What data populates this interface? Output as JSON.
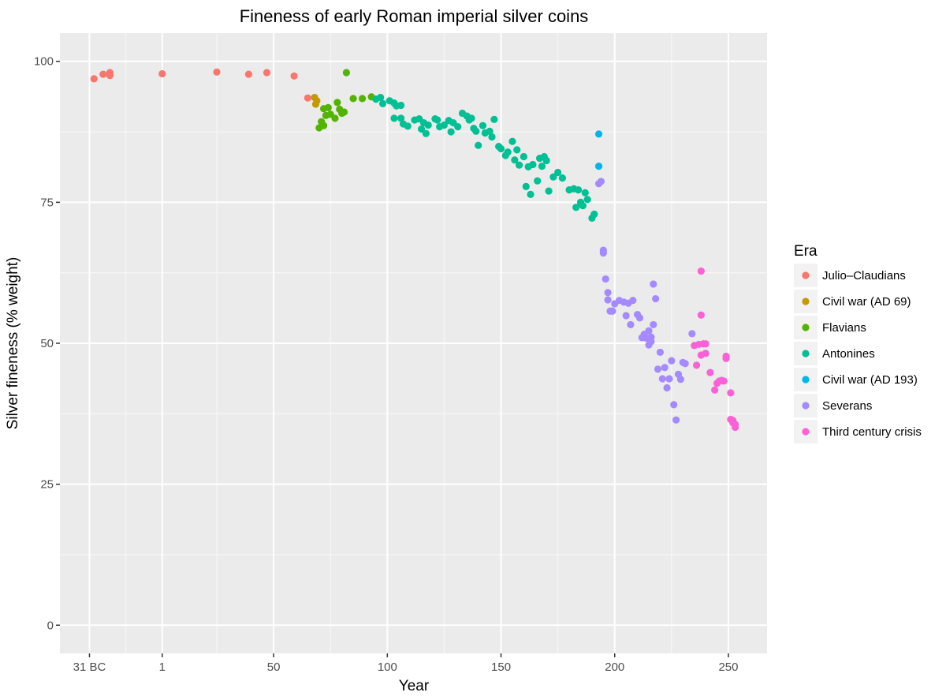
{
  "chart_data": {
    "type": "scatter",
    "title": "Fineness of early Roman imperial silver coins",
    "xlabel": "Year",
    "ylabel": "Silver fineness (% weight)",
    "xlim": [
      -44,
      267
    ],
    "ylim": [
      -5,
      105
    ],
    "x_ticks": [
      {
        "value": -31,
        "label": "31 BC"
      },
      {
        "value": 1,
        "label": "1"
      },
      {
        "value": 50,
        "label": "50"
      },
      {
        "value": 100,
        "label": "100"
      },
      {
        "value": 150,
        "label": "150"
      },
      {
        "value": 200,
        "label": "200"
      },
      {
        "value": 250,
        "label": "250"
      }
    ],
    "x_minor": [
      -15,
      25,
      75,
      125,
      175,
      225
    ],
    "y_ticks": [
      {
        "value": 0,
        "label": "0"
      },
      {
        "value": 25,
        "label": "25"
      },
      {
        "value": 50,
        "label": "50"
      },
      {
        "value": 75,
        "label": "75"
      },
      {
        "value": 100,
        "label": "100"
      }
    ],
    "y_minor": [
      12.5,
      37.5,
      62.5,
      87.5
    ],
    "grid": true,
    "legend": {
      "title": "Era",
      "placement": "right"
    },
    "series": [
      {
        "name": "Julio–Claudians",
        "color": "#F8766D",
        "points": [
          [
            -29,
            96.9
          ],
          [
            -25,
            97.7
          ],
          [
            -22,
            98.0
          ],
          [
            -22,
            97.5
          ],
          [
            1,
            97.8
          ],
          [
            25,
            98.1
          ],
          [
            39,
            97.7
          ],
          [
            47,
            98.0
          ],
          [
            59,
            97.4
          ],
          [
            65,
            93.5
          ]
        ]
      },
      {
        "name": "Civil war (AD 69)",
        "color": "#C49A00",
        "points": [
          [
            68,
            93.6
          ],
          [
            69,
            93.0
          ],
          [
            68.5,
            92.4
          ]
        ]
      },
      {
        "name": "Flavians",
        "color": "#53B400",
        "points": [
          [
            72,
            91.6
          ],
          [
            74,
            91.8
          ],
          [
            78,
            92.7
          ],
          [
            75,
            90.6
          ],
          [
            73,
            90.4
          ],
          [
            79,
            91.5
          ],
          [
            80,
            90.8
          ],
          [
            81,
            91.0
          ],
          [
            77,
            89.9
          ],
          [
            71,
            89.3
          ],
          [
            72,
            88.6
          ],
          [
            70,
            88.2
          ],
          [
            82,
            98.0
          ],
          [
            85,
            93.4
          ],
          [
            89,
            93.4
          ],
          [
            93,
            93.7
          ]
        ]
      },
      {
        "name": "Antonines",
        "color": "#00C094",
        "points": [
          [
            95,
            93.3
          ],
          [
            97,
            93.6
          ],
          [
            98,
            92.5
          ],
          [
            101,
            93.0
          ],
          [
            103,
            92.6
          ],
          [
            104,
            92.1
          ],
          [
            106,
            92.2
          ],
          [
            103,
            89.9
          ],
          [
            106,
            89.9
          ],
          [
            107,
            88.9
          ],
          [
            109,
            88.5
          ],
          [
            112,
            89.6
          ],
          [
            114,
            89.8
          ],
          [
            116,
            89.1
          ],
          [
            115,
            88.0
          ],
          [
            117,
            87.2
          ],
          [
            118,
            88.7
          ],
          [
            121,
            89.8
          ],
          [
            122,
            89.6
          ],
          [
            123,
            88.4
          ],
          [
            125,
            88.7
          ],
          [
            127,
            89.5
          ],
          [
            128,
            87.5
          ],
          [
            129,
            89.1
          ],
          [
            131,
            88.4
          ],
          [
            133,
            90.8
          ],
          [
            135,
            90.3
          ],
          [
            136,
            89.6
          ],
          [
            137,
            89.9
          ],
          [
            138,
            88.1
          ],
          [
            139,
            87.6
          ],
          [
            140,
            85.1
          ],
          [
            142,
            88.6
          ],
          [
            143,
            87.3
          ],
          [
            145,
            87.6
          ],
          [
            146,
            86.6
          ],
          [
            147,
            89.7
          ],
          [
            149,
            84.9
          ],
          [
            150,
            84.5
          ],
          [
            152,
            83.3
          ],
          [
            153,
            83.9
          ],
          [
            155,
            85.8
          ],
          [
            156,
            82.5
          ],
          [
            157,
            84.3
          ],
          [
            158,
            81.6
          ],
          [
            160,
            83.1
          ],
          [
            161,
            77.8
          ],
          [
            162,
            81.3
          ],
          [
            163,
            76.4
          ],
          [
            164,
            81.7
          ],
          [
            166,
            78.8
          ],
          [
            167,
            82.8
          ],
          [
            168,
            81.4
          ],
          [
            169,
            83.1
          ],
          [
            170,
            82.4
          ],
          [
            171,
            77.0
          ],
          [
            173,
            79.5
          ],
          [
            175,
            80.3
          ],
          [
            177,
            79.3
          ],
          [
            180,
            77.2
          ],
          [
            182,
            77.4
          ],
          [
            183,
            74.1
          ],
          [
            184,
            77.2
          ],
          [
            185,
            75.0
          ],
          [
            186,
            74.4
          ],
          [
            187,
            76.7
          ],
          [
            188,
            75.5
          ],
          [
            190,
            72.2
          ],
          [
            191,
            72.9
          ]
        ]
      },
      {
        "name": "Civil war (AD 193)",
        "color": "#00B6EB",
        "points": [
          [
            193,
            87.1
          ],
          [
            193,
            81.4
          ]
        ]
      },
      {
        "name": "Severans",
        "color": "#A58AFF",
        "points": [
          [
            193,
            78.3
          ],
          [
            194,
            78.7
          ],
          [
            195,
            66.5
          ],
          [
            195,
            66.0
          ],
          [
            196,
            61.4
          ],
          [
            197,
            59.0
          ],
          [
            197,
            57.7
          ],
          [
            198,
            55.7
          ],
          [
            199,
            55.7
          ],
          [
            200,
            57.0
          ],
          [
            202,
            57.6
          ],
          [
            204,
            57.3
          ],
          [
            205,
            54.9
          ],
          [
            206,
            57.1
          ],
          [
            207,
            53.3
          ],
          [
            208,
            57.6
          ],
          [
            210,
            55.1
          ],
          [
            211,
            54.5
          ],
          [
            212,
            51.0
          ],
          [
            213,
            51.6
          ],
          [
            214,
            50.9
          ],
          [
            215,
            52.2
          ],
          [
            215,
            49.7
          ],
          [
            216,
            50.3
          ],
          [
            216,
            51.1
          ],
          [
            217,
            53.3
          ],
          [
            217,
            60.5
          ],
          [
            218,
            57.9
          ],
          [
            219,
            45.4
          ],
          [
            220,
            48.4
          ],
          [
            221,
            43.7
          ],
          [
            222,
            45.7
          ],
          [
            223,
            42.1
          ],
          [
            224,
            43.7
          ],
          [
            225,
            46.9
          ],
          [
            226,
            39.1
          ],
          [
            227,
            36.4
          ],
          [
            228,
            44.5
          ],
          [
            229,
            43.6
          ],
          [
            230,
            46.6
          ],
          [
            231,
            46.4
          ],
          [
            234,
            51.7
          ]
        ]
      },
      {
        "name": "Third century crisis",
        "color": "#FB61D7",
        "points": [
          [
            235,
            49.6
          ],
          [
            237,
            49.8
          ],
          [
            238,
            62.8
          ],
          [
            238,
            55.0
          ],
          [
            239,
            49.9
          ],
          [
            240,
            49.9
          ],
          [
            238,
            47.9
          ],
          [
            240,
            48.2
          ],
          [
            236,
            46.1
          ],
          [
            242,
            44.8
          ],
          [
            244,
            41.7
          ],
          [
            245,
            42.9
          ],
          [
            246,
            43.3
          ],
          [
            247,
            43.4
          ],
          [
            248,
            43.3
          ],
          [
            249,
            47.3
          ],
          [
            249,
            47.7
          ],
          [
            251,
            41.2
          ],
          [
            251,
            36.5
          ],
          [
            252,
            36.3
          ],
          [
            252,
            35.9
          ],
          [
            253,
            35.6
          ],
          [
            253,
            35.1
          ]
        ]
      }
    ]
  }
}
